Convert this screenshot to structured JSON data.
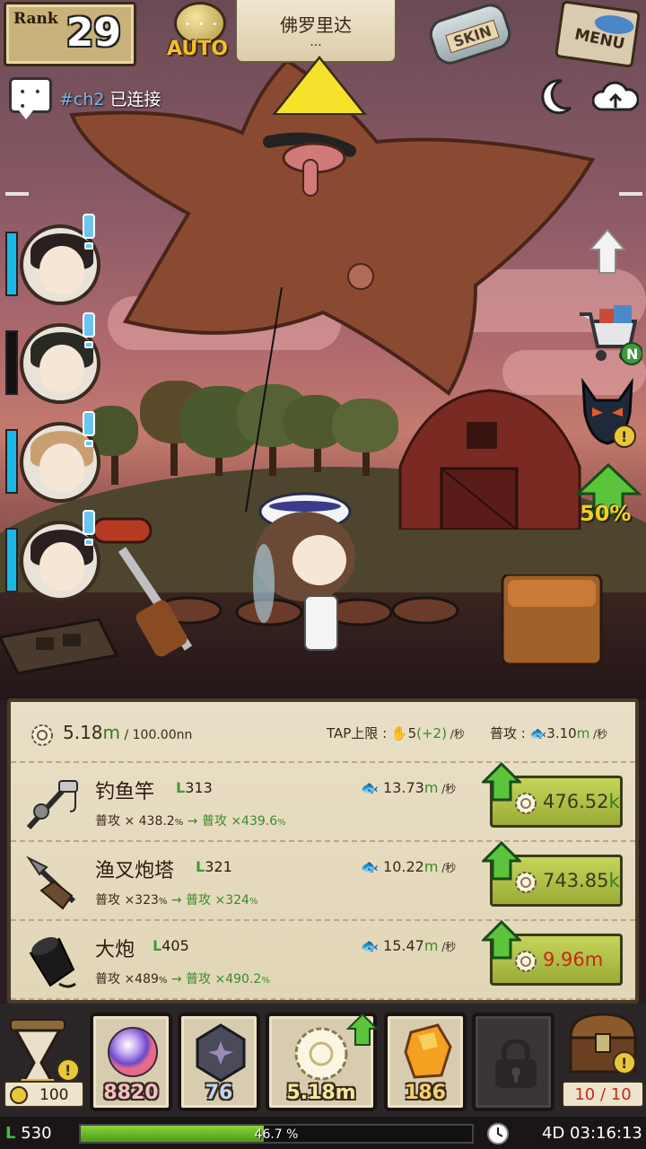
{
  "top": {
    "rank_label": "Rank",
    "rank_value": "29",
    "auto_label": "AUTO",
    "auto_dots": "• • •",
    "location_title": "佛罗里达",
    "location_sub": "...",
    "skin_label": "SKIN",
    "menu_label": "MENU"
  },
  "chat": {
    "dots": "• • •",
    "channel": "#ch2",
    "status": "已连接"
  },
  "right_buttons": {
    "boost_text": "50%"
  },
  "party": [
    {
      "name": "party-member-1",
      "hp": 1.0,
      "hair": "#2a2020"
    },
    {
      "name": "party-member-2",
      "hp": 0.0,
      "hair": "#2a2a24"
    },
    {
      "name": "party-member-3",
      "hp": 1.0,
      "hair": "#c8a070"
    },
    {
      "name": "party-member-4",
      "hp": 1.0,
      "hair": "#2a2020"
    }
  ],
  "panel": {
    "gold_value": "5.18",
    "gold_unit": "m",
    "gold_max": " / 100.00nn",
    "tap_label": "TAP上限 : ",
    "tap_value": "5",
    "tap_bonus": "(+2)",
    "tap_unit": " /秒",
    "atk_label": "普攻 : ",
    "atk_value": "3.10",
    "atk_unit_m": "m",
    "atk_unit": " /秒"
  },
  "upgrades": [
    {
      "name": "钓鱼竿",
      "level": "313",
      "stat_label": "普攻 × 438.2",
      "stat_pct": "%",
      "stat_next": " → 普攻 ×439.6",
      "dps_value": "13.73",
      "dps_unit_m": "m",
      "dps_unit": " /秒",
      "cost_value": "476.52",
      "cost_unit": "k",
      "cost_red": false
    },
    {
      "name": "渔叉炮塔",
      "level": "321",
      "stat_label": "普攻 ×323",
      "stat_pct": "%",
      "stat_next": " → 普攻 ×324",
      "dps_value": "10.22",
      "dps_unit_m": "m",
      "dps_unit": " /秒",
      "cost_value": "743.85",
      "cost_unit": "k",
      "cost_red": false
    },
    {
      "name": "大炮",
      "level": "405",
      "stat_label": "普攻 ×489",
      "stat_pct": "%",
      "stat_next": " → 普攻 ×490.2",
      "dps_value": "15.47",
      "dps_unit_m": "m",
      "dps_unit": " /秒",
      "cost_value": "9.96",
      "cost_unit": "m",
      "cost_red": true
    }
  ],
  "bottom": {
    "hourglass_count": "100",
    "orb_count": "8820",
    "gem_count": "76",
    "coin_count": "5.18m",
    "amber_count": "186",
    "chest_count": "10 / 10"
  },
  "status": {
    "level_label": "530",
    "xp_percent_text": "46.7 %",
    "xp_fraction": 0.467,
    "time": "4D 03:16:13"
  },
  "colors": {
    "hp_blue": "#1ab8e6",
    "buy_green": "#c6d45a",
    "cost_red": "#c8281a",
    "xp_green": "#8ad43a"
  }
}
